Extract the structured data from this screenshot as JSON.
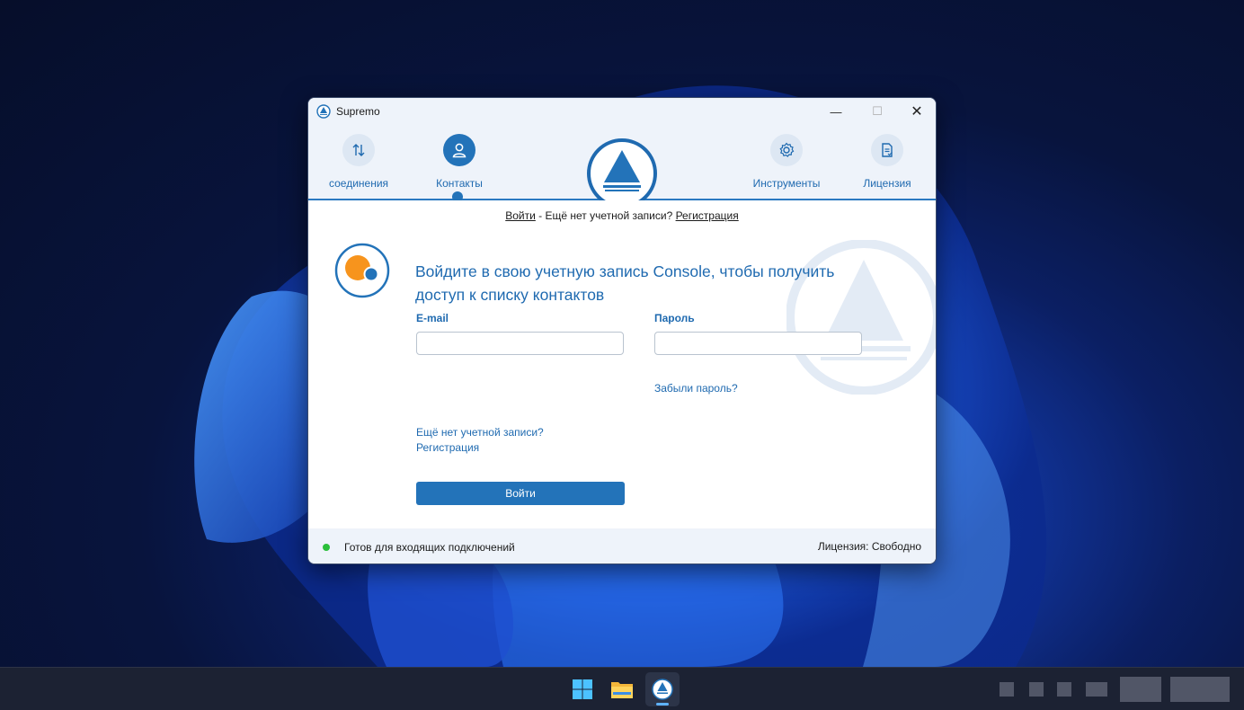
{
  "window": {
    "title": "Supremo",
    "controls": {
      "minimize": "—",
      "maximize": "☐",
      "close": "✕"
    }
  },
  "nav": {
    "items": [
      {
        "label": "соединения",
        "icon": "arrows-updown-icon",
        "active": false
      },
      {
        "label": "Контакты",
        "icon": "user-icon",
        "active": true
      },
      {
        "label": "Инструменты",
        "icon": "gear-icon",
        "active": false
      },
      {
        "label": "Лицензия",
        "icon": "license-document-icon",
        "active": false
      }
    ]
  },
  "login": {
    "topline": {
      "login_link": "Войти",
      "middle": " - Ещё нет учетной записи? ",
      "register_link": "Регистрация"
    },
    "heading": "Войдите в свою учетную запись Console, чтобы получить доступ к списку контактов",
    "email_label": "E-mail",
    "email_value": "",
    "password_label": "Пароль",
    "password_value": "",
    "login_button": "Войти",
    "forgot_password": "Забыли пароль?",
    "no_account": "Ещё нет учетной записи?",
    "register": "Регистрация"
  },
  "status": {
    "text": "Готов для входящих подключений",
    "license": "Лицензия: Свободно",
    "indicator_color": "#2bbf3b"
  },
  "colors": {
    "accent": "#2373b9",
    "link": "#1f6ab0",
    "panel": "#eef3fa"
  },
  "taskbar": {
    "apps": [
      {
        "icon": "windows-start-icon",
        "active": false
      },
      {
        "icon": "file-explorer-icon",
        "active": false
      },
      {
        "icon": "supremo-app-icon",
        "active": true
      }
    ]
  }
}
